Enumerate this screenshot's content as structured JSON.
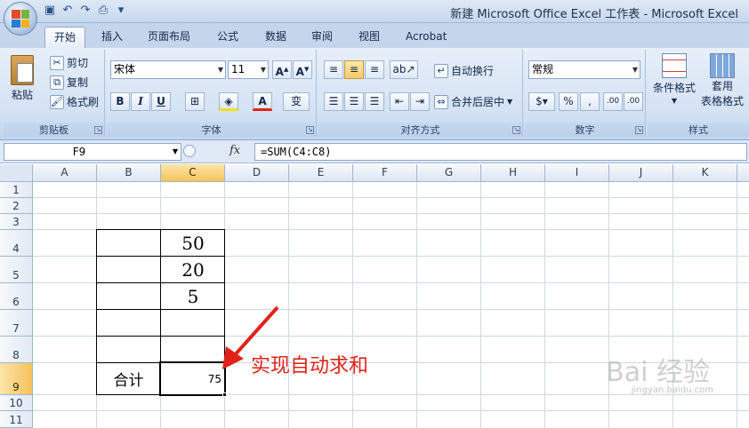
{
  "window": {
    "title": "新建 Microsoft Office Excel 工作表 - Microsoft Excel"
  },
  "tabs": [
    "开始",
    "插入",
    "页面布局",
    "公式",
    "数据",
    "审阅",
    "视图",
    "Acrobat"
  ],
  "ribbon": {
    "clipboard": {
      "label": "剪贴板",
      "paste": "粘贴",
      "cut": "剪切",
      "copy": "复制",
      "format_painter": "格式刷"
    },
    "font": {
      "label": "字体",
      "font_name": "宋体",
      "font_size": "11",
      "bold": "B",
      "italic": "I",
      "underline": "U",
      "phonetic": "变"
    },
    "alignment": {
      "label": "对齐方式",
      "wrap_text": "自动换行",
      "merge_center": "合并后居中"
    },
    "number": {
      "label": "数字",
      "format": "常规",
      "percent": "%",
      "comma": ",",
      "inc_decimal": ".00",
      "dec_decimal": ".00"
    },
    "styles": {
      "label": "样式",
      "conditional": "条件格式",
      "table_format_1": "套用",
      "table_format_2": "表格格式"
    }
  },
  "formula_bar": {
    "name_box": "F9",
    "fx": "fx",
    "formula": "=SUM(C4:C8)"
  },
  "columns": [
    "A",
    "B",
    "C",
    "D",
    "E",
    "F",
    "G",
    "H",
    "I",
    "J",
    "K"
  ],
  "rows": [
    "1",
    "2",
    "3",
    "4",
    "5",
    "6",
    "7",
    "8",
    "9",
    "10",
    "11"
  ],
  "cells": {
    "C4": "50",
    "C5": "20",
    "C6": "5",
    "B9": "合计",
    "C9": "75"
  },
  "annotation": "实现自动求和",
  "watermark": {
    "main": "Bai 经验",
    "sub": "jingyan.baidu.com"
  },
  "colors": {
    "annotation_red": "#e0231a",
    "selected_header": "#f6c35c"
  }
}
